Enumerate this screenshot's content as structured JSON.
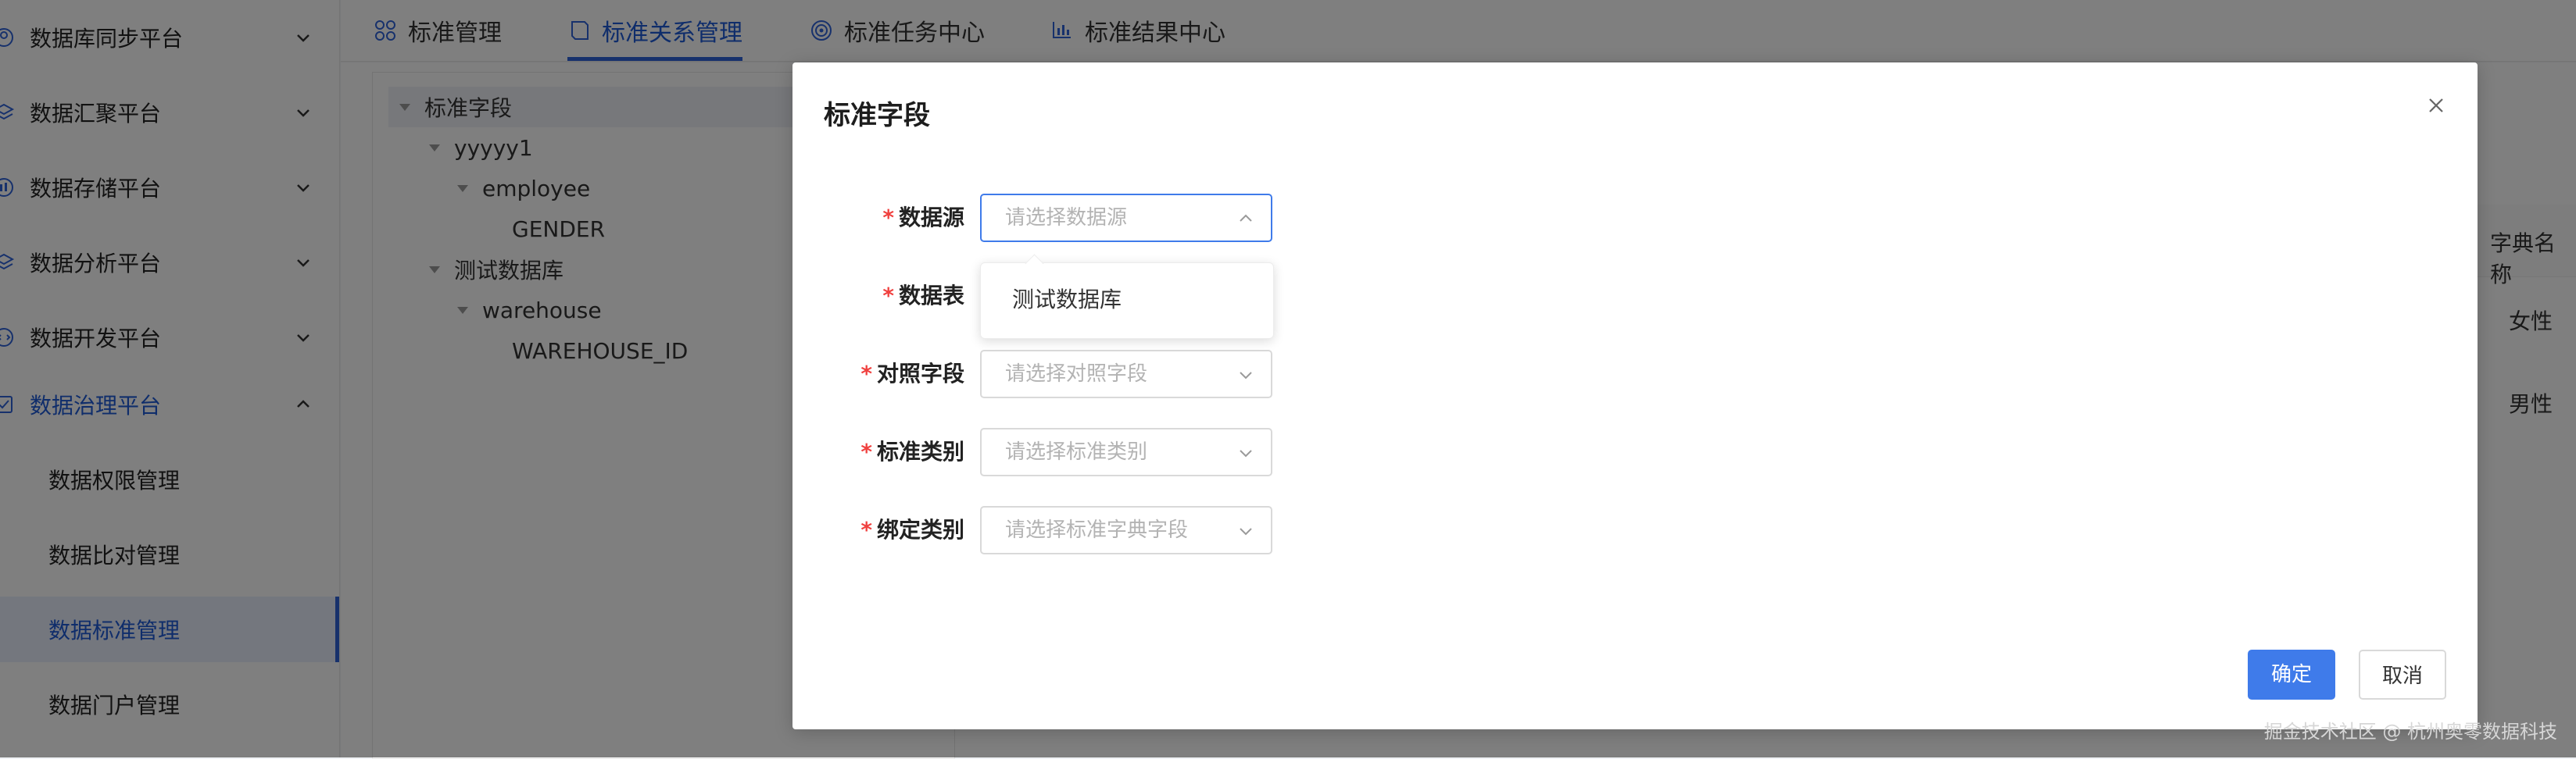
{
  "sidebar": {
    "items": [
      {
        "label": "数据库同步平台",
        "icon": "sync-icon"
      },
      {
        "label": "数据汇聚平台",
        "icon": "layers-icon"
      },
      {
        "label": "数据存储平台",
        "icon": "storage-icon"
      },
      {
        "label": "数据分析平台",
        "icon": "analysis-icon"
      },
      {
        "label": "数据开发平台",
        "icon": "dev-icon"
      },
      {
        "label": "数据治理平台",
        "icon": "governance-icon"
      }
    ],
    "subitems": [
      {
        "label": "数据权限管理"
      },
      {
        "label": "数据比对管理"
      },
      {
        "label": "数据标准管理"
      },
      {
        "label": "数据门户管理"
      }
    ],
    "active_color": "#1f5bd6"
  },
  "tabs": [
    {
      "label": "标准管理",
      "icon": "grid-icon"
    },
    {
      "label": "标准关系管理",
      "icon": "book-icon"
    },
    {
      "label": "标准任务中心",
      "icon": "target-icon"
    },
    {
      "label": "标准结果中心",
      "icon": "chart-icon"
    }
  ],
  "tree": {
    "root": "标准字段",
    "nodes": [
      {
        "label": "yyyyy1"
      },
      {
        "label": "employee"
      },
      {
        "label": "GENDER"
      },
      {
        "label": "测试数据库"
      },
      {
        "label": "warehouse"
      },
      {
        "label": "WAREHOUSE_ID"
      }
    ]
  },
  "table": {
    "header": "字典名称",
    "rows": [
      "女性",
      "男性"
    ]
  },
  "modal": {
    "title": "标准字段",
    "fields": [
      {
        "label": "数据源",
        "placeholder": "请选择数据源"
      },
      {
        "label": "数据表",
        "placeholder": ""
      },
      {
        "label": "对照字段",
        "placeholder": "请选择对照字段"
      },
      {
        "label": "标准类别",
        "placeholder": "请选择标准类别"
      },
      {
        "label": "绑定类别",
        "placeholder": "请选择标准字典字段"
      }
    ],
    "required_mark": "*",
    "dropdown_option": "测试数据库",
    "confirm_label": "确定",
    "cancel_label": "取消",
    "primary_color": "#3f7bea"
  },
  "watermark": "掘金技术社区 @ 杭州奥零数据科技"
}
